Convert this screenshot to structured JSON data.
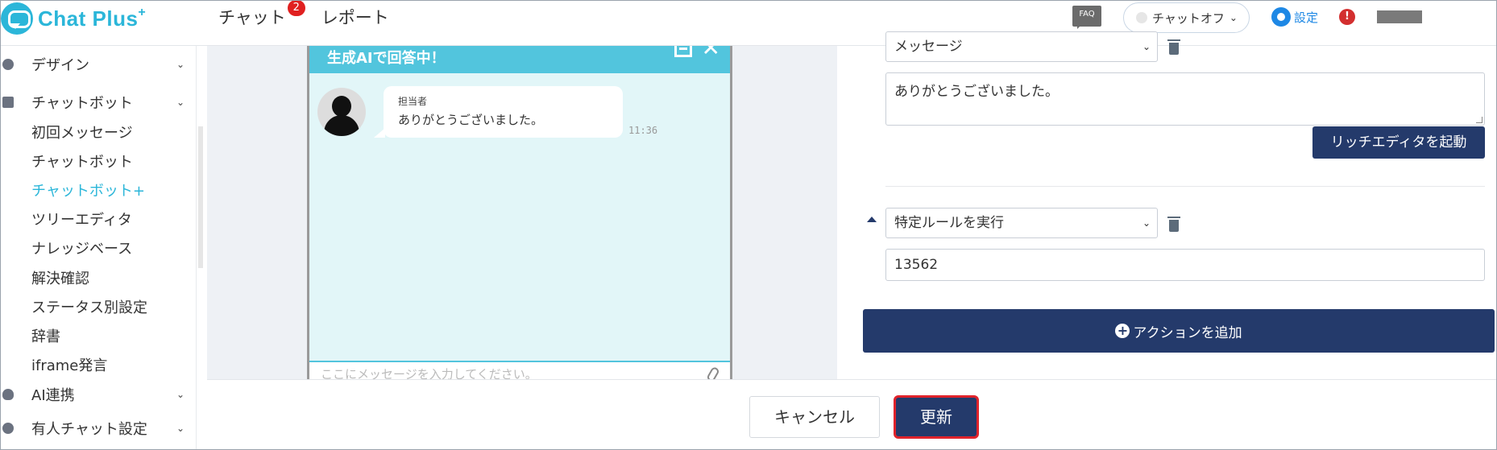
{
  "header": {
    "logo_text": "Chat Plus",
    "logo_sup": "+",
    "nav": [
      {
        "label": "チャット",
        "badge": "2"
      },
      {
        "label": "レポート"
      }
    ],
    "faq": "FAQ",
    "chat_status": "チャットオフ",
    "settings": "設定",
    "alert": "!"
  },
  "sidebar": {
    "sections": [
      {
        "label": "デザイン",
        "icon": "palette-icon"
      },
      {
        "label": "チャットボット",
        "icon": "chat-icon"
      },
      {
        "label": "AI連携",
        "icon": "bulb-icon"
      },
      {
        "label": "有人チャット設定",
        "icon": "person-icon"
      }
    ],
    "items": [
      {
        "label": "初回メッセージ"
      },
      {
        "label": "チャットボット"
      },
      {
        "label": "チャットボット+",
        "active": true
      },
      {
        "label": "ツリーエディタ"
      },
      {
        "label": "ナレッジベース"
      },
      {
        "label": "解決確認"
      },
      {
        "label": "ステータス別設定"
      },
      {
        "label": "辞書"
      },
      {
        "label": "iframe発言"
      }
    ]
  },
  "preview": {
    "header_title": "生成AIで回答中！",
    "agent_name": "担当者",
    "message": "ありがとうございました。",
    "time": "11:36",
    "input_placeholder": "ここにメッセージを入力してください。"
  },
  "editor": {
    "top_select": "メッセージ",
    "message_text": "ありがとうございました。",
    "rich_editor_button": "リッチエディタを起動",
    "action_select": "特定ルールを実行",
    "rule_id": "13562",
    "add_action_button": "アクションを追加"
  },
  "footer": {
    "cancel": "キャンセル",
    "update": "更新"
  },
  "colors": {
    "brand": "#2bb6d9",
    "navy": "#243a6b",
    "preview_header": "#52c5dd",
    "highlight_border": "#e0232b"
  }
}
